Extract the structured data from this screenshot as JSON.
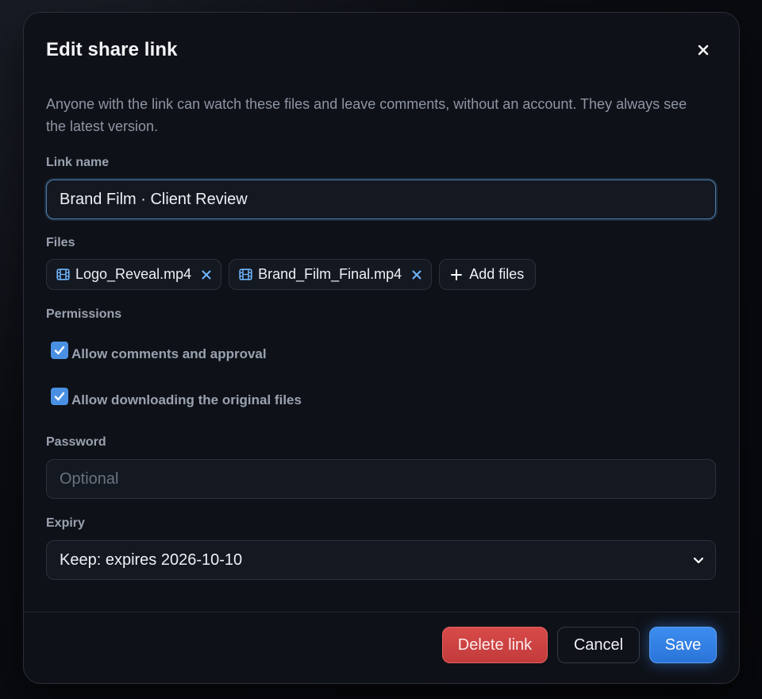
{
  "dialog": {
    "title": "Edit share link",
    "description": "Anyone with the link can watch these files and leave comments, without an account. They always see the latest version."
  },
  "link_name": {
    "label": "Link name",
    "value": "Brand Film · Client Review"
  },
  "files": {
    "label": "Files",
    "items": [
      {
        "name": "Logo_Reveal.mp4"
      },
      {
        "name": "Brand_Film_Final.mp4"
      }
    ],
    "add_label": "Add files"
  },
  "permissions": {
    "label": "Permissions",
    "options": [
      {
        "label": "Allow comments and approval",
        "checked": true
      },
      {
        "label": "Allow downloading the original files",
        "checked": true
      }
    ]
  },
  "password": {
    "label": "Password",
    "value": "",
    "placeholder": "Optional"
  },
  "expiry": {
    "label": "Expiry",
    "selected": "Keep: expires 2026-10-10"
  },
  "footer": {
    "delete_label": "Delete link",
    "cancel_label": "Cancel",
    "save_label": "Save"
  },
  "colors": {
    "accent": "#3d8df0",
    "danger": "#d84a4a",
    "chip_icon": "#6fb6ff",
    "checkbox": "#4a90e2"
  },
  "icons": {
    "close": "close-icon",
    "file": "film-icon",
    "remove": "remove-icon",
    "add": "plus-icon",
    "check": "checkmark-icon",
    "dropdown": "chevron-down-icon"
  }
}
